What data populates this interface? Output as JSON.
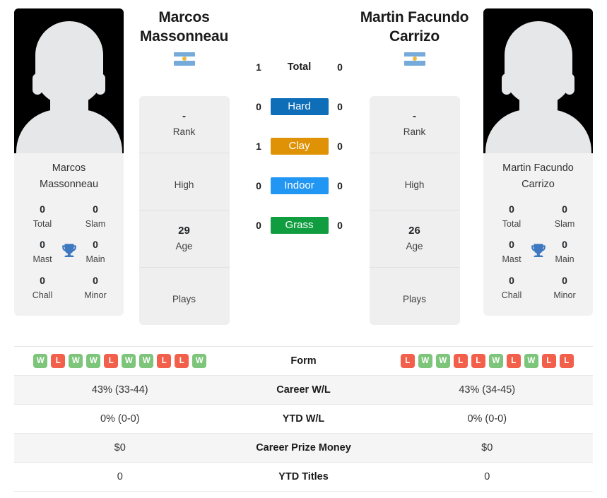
{
  "colors": {
    "hard": "#0E6EB8",
    "clay": "#DF9206",
    "indoor": "#2196F3",
    "grass": "#0F9D3F",
    "win": "#7DC57A",
    "loss": "#F2604C",
    "trophy": "#3D78C0",
    "flag_blue": "#75AADB",
    "flag_sun": "#F0B83C"
  },
  "players": {
    "left": {
      "name": "Marcos Massonneau",
      "name_line1": "Marcos",
      "name_line2": "Massonneau",
      "card_name_line1": "Marcos",
      "card_name_line2": "Massonneau",
      "country": "Argentina",
      "flag_icon": "argentina-flag-icon",
      "titles": {
        "total": "0",
        "total_label": "Total",
        "slam": "0",
        "slam_label": "Slam",
        "mast": "0",
        "mast_label": "Mast",
        "main": "0",
        "main_label": "Main",
        "chall": "0",
        "chall_label": "Chall",
        "minor": "0",
        "minor_label": "Minor"
      },
      "info": [
        {
          "value": "-",
          "label": "Rank"
        },
        {
          "value": "",
          "label": "High"
        },
        {
          "value": "29",
          "label": "Age"
        },
        {
          "value": "",
          "label": "Plays"
        }
      ],
      "form": [
        "W",
        "L",
        "W",
        "W",
        "L",
        "W",
        "W",
        "L",
        "L",
        "W"
      ],
      "career_wl": "43% (33-44)",
      "ytd_wl": "0% (0-0)",
      "career_prize_money": "$0",
      "ytd_titles": "0",
      "surface_wins": {
        "total": "1",
        "hard": "0",
        "clay": "1",
        "indoor": "0",
        "grass": "0"
      }
    },
    "right": {
      "name": "Martin Facundo Carrizo",
      "name_line1": "Martin Facundo",
      "name_line2": "Carrizo",
      "card_name_line1": "Martin Facundo",
      "card_name_line2": "Carrizo",
      "country": "Argentina",
      "flag_icon": "argentina-flag-icon",
      "titles": {
        "total": "0",
        "total_label": "Total",
        "slam": "0",
        "slam_label": "Slam",
        "mast": "0",
        "mast_label": "Mast",
        "main": "0",
        "main_label": "Main",
        "chall": "0",
        "chall_label": "Chall",
        "minor": "0",
        "minor_label": "Minor"
      },
      "info": [
        {
          "value": "-",
          "label": "Rank"
        },
        {
          "value": "",
          "label": "High"
        },
        {
          "value": "26",
          "label": "Age"
        },
        {
          "value": "",
          "label": "Plays"
        }
      ],
      "form": [
        "L",
        "W",
        "W",
        "L",
        "L",
        "W",
        "L",
        "W",
        "L",
        "L"
      ],
      "career_wl": "43% (34-45)",
      "ytd_wl": "0% (0-0)",
      "career_prize_money": "$0",
      "ytd_titles": "0",
      "surface_wins": {
        "total": "0",
        "hard": "0",
        "clay": "0",
        "indoor": "0",
        "grass": "0"
      }
    }
  },
  "surfaces": [
    {
      "key": "total",
      "label": "Total",
      "badge": false,
      "color": ""
    },
    {
      "key": "hard",
      "label": "Hard",
      "badge": true,
      "color": "#0E6EB8"
    },
    {
      "key": "clay",
      "label": "Clay",
      "badge": true,
      "color": "#DF9206"
    },
    {
      "key": "indoor",
      "label": "Indoor",
      "badge": true,
      "color": "#2196F3"
    },
    {
      "key": "grass",
      "label": "Grass",
      "badge": true,
      "color": "#0F9D3F"
    }
  ],
  "table_rows": [
    {
      "label": "Form",
      "key": "form",
      "type": "form"
    },
    {
      "label": "Career W/L",
      "key": "career_wl",
      "type": "text"
    },
    {
      "label": "YTD W/L",
      "key": "ytd_wl",
      "type": "text"
    },
    {
      "label": "Career Prize Money",
      "key": "career_prize_money",
      "type": "text"
    },
    {
      "label": "YTD Titles",
      "key": "ytd_titles",
      "type": "text"
    }
  ]
}
